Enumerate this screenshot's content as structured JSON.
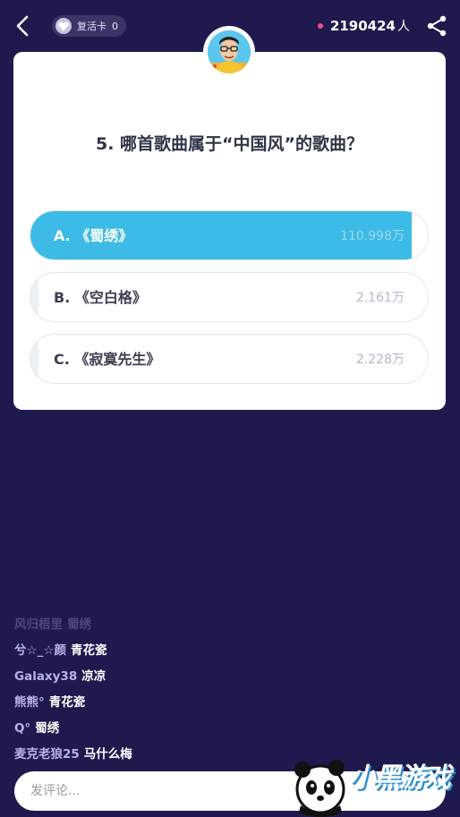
{
  "header": {
    "revive_card_label": "复活卡",
    "revive_card_count": "0",
    "viewer_count": "2190424",
    "viewer_unit": "人"
  },
  "question": {
    "text": "5. 哪首歌曲属于“中国风”的歌曲？",
    "options": [
      {
        "label": "A. 《蜀绣》",
        "votes": "110.998万",
        "share": 0.96,
        "selected": true
      },
      {
        "label": "B. 《空白格》",
        "votes": "2.161万",
        "share": 0.02,
        "selected": false
      },
      {
        "label": "C. 《寂寞先生》",
        "votes": "2.228万",
        "share": 0.02,
        "selected": false
      }
    ]
  },
  "comments": [
    {
      "user": "风归梧里",
      "msg": "蜀绣",
      "faded": true
    },
    {
      "user": "兮☆_☆颜",
      "msg": "青花瓷",
      "faded": false
    },
    {
      "user": "Galaxy38",
      "msg": "凉凉",
      "faded": false
    },
    {
      "user": "熊熊°",
      "msg": "青花瓷",
      "faded": false
    },
    {
      "user": "Q°",
      "msg": "蜀绣",
      "faded": false
    },
    {
      "user": "麦克老狼25",
      "msg": "马什么梅",
      "faded": false
    }
  ],
  "input": {
    "placeholder": "发评论..."
  },
  "watermark": {
    "text": "小黑游戏",
    "url": "www.xiaohei.com"
  },
  "colors": {
    "background": "#1f1a4e",
    "accent": "#3bbbe6",
    "live_dot": "#ff4d7a"
  }
}
